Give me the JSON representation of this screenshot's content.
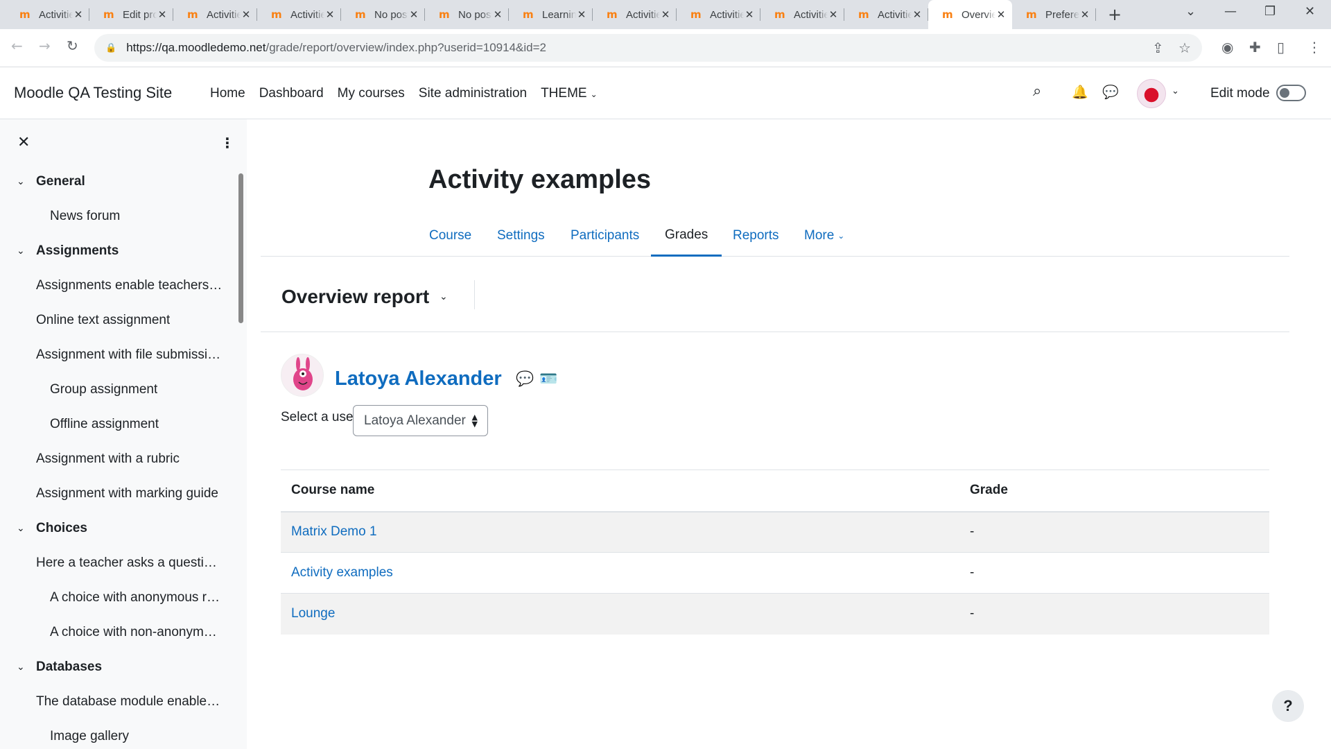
{
  "browser": {
    "tabs": [
      {
        "title": "Activities"
      },
      {
        "title": "Edit profile"
      },
      {
        "title": "Activities"
      },
      {
        "title": "Activities"
      },
      {
        "title": "No posts"
      },
      {
        "title": "No posts"
      },
      {
        "title": "Learning"
      },
      {
        "title": "Activities"
      },
      {
        "title": "Activities"
      },
      {
        "title": "Activities"
      },
      {
        "title": "Activities"
      },
      {
        "title": "Overview",
        "active": true
      },
      {
        "title": "Preferences"
      }
    ],
    "url_host": "https://qa.moodledemo.net",
    "url_path": "/grade/report/overview/index.php?userid=10914&id=2"
  },
  "navbar": {
    "brand": "Moodle QA Testing Site",
    "links": [
      "Home",
      "Dashboard",
      "My courses",
      "Site administration",
      "THEME"
    ],
    "edit_mode_label": "Edit mode"
  },
  "drawer": {
    "items": [
      {
        "label": "General",
        "type": "section"
      },
      {
        "label": "News forum",
        "type": "l2"
      },
      {
        "label": "Assignments",
        "type": "section"
      },
      {
        "label": "Assignments enable teachers to grade and give comments on uploaded files",
        "type": "l1"
      },
      {
        "label": "Online text assignment",
        "type": "l1"
      },
      {
        "label": "Assignment with file submissions",
        "type": "l1"
      },
      {
        "label": "Group assignment",
        "type": "l2"
      },
      {
        "label": "Offline assignment",
        "type": "l2"
      },
      {
        "label": "Assignment with a rubric",
        "type": "l1"
      },
      {
        "label": "Assignment with marking guide",
        "type": "l1"
      },
      {
        "label": "Choices",
        "type": "section"
      },
      {
        "label": "Here a teacher asks a question and specifies a choice of multiple responses",
        "type": "l1"
      },
      {
        "label": "A choice with anonymous results",
        "type": "l2"
      },
      {
        "label": "A choice with non-anonymous results",
        "type": "l2"
      },
      {
        "label": "Databases",
        "type": "section"
      },
      {
        "label": "The database module enables participants to create, maintain and search",
        "type": "l1"
      },
      {
        "label": "Image gallery",
        "type": "l2"
      }
    ]
  },
  "course": {
    "title": "Activity examples",
    "tabs": [
      "Course",
      "Settings",
      "Participants",
      "Grades",
      "Reports",
      "More"
    ],
    "active_tab": "Grades"
  },
  "report": {
    "title": "Overview report",
    "user_name": "Latoya Alexander",
    "select_label": "Select a user",
    "selected_user": "Latoya Alexander",
    "table": {
      "headers": [
        "Course name",
        "Grade"
      ],
      "rows": [
        {
          "course": "Matrix Demo 1",
          "grade": "-"
        },
        {
          "course": "Activity examples",
          "grade": "-"
        },
        {
          "course": "Lounge",
          "grade": "-"
        }
      ]
    }
  },
  "help_label": "?",
  "colors": {
    "link": "#0f6cbf",
    "moodle_orange": "#f98012",
    "text": "#1d2125"
  },
  "icons": [
    "search-icon",
    "bell-icon",
    "chat-icon",
    "close-icon",
    "kebab-icon",
    "message-icon",
    "id-card-icon"
  ]
}
